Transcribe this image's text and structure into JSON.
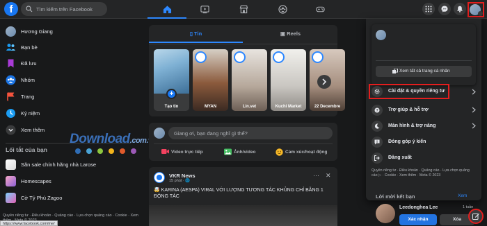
{
  "topbar": {
    "logo": "f",
    "search_placeholder": "Tìm kiếm trên Facebook",
    "nav_icons": [
      "home-icon",
      "watch-icon",
      "marketplace-icon",
      "groups-icon",
      "gaming-icon"
    ],
    "right_icons": [
      "menu-grid-icon",
      "messenger-icon",
      "notifications-icon"
    ]
  },
  "sidebar": {
    "items": [
      {
        "label": "Hương Giang",
        "icon": "avatar"
      },
      {
        "label": "Bạn bè",
        "icon": "friends-icon"
      },
      {
        "label": "Đã lưu",
        "icon": "saved-icon"
      },
      {
        "label": "Nhóm",
        "icon": "groups-icon"
      },
      {
        "label": "Trang",
        "icon": "pages-icon"
      },
      {
        "label": "Kỷ niệm",
        "icon": "memories-icon"
      },
      {
        "label": "Xem thêm",
        "icon": "chevron-down-icon"
      }
    ],
    "shortcuts_title": "Lối tắt của bạn",
    "shortcuts": [
      {
        "label": "Săn sale chính hãng nhà Larose"
      },
      {
        "label": "Homescapes"
      },
      {
        "label": "Cờ Tỷ Phú Zagoo"
      }
    ],
    "footer": "Quyền riêng tư · Điều khoản · Quảng cáo · Lựa chọn quảng cáo · Cookie · Xem thêm · Meta © 2023"
  },
  "status_url": "https://www.facebook.com/me/",
  "watermark": {
    "main": "Download",
    "tld": ".com.vn"
  },
  "stories": {
    "tabs": [
      "Tin",
      "Reels"
    ],
    "create_label": "Tạo tin",
    "items": [
      {
        "name": "MYAN"
      },
      {
        "name": "Lin.vet"
      },
      {
        "name": "Kuchi Market"
      },
      {
        "name": "22 Decembre"
      }
    ]
  },
  "composer": {
    "placeholder": "Giang ơi, bạn đang nghĩ gì thế?",
    "actions": [
      "Video trực tiếp",
      "Ảnh/video",
      "Cảm xúc/hoạt động"
    ]
  },
  "post": {
    "page_name": "VKR News",
    "meta": "15 phút · 🌐",
    "text": "🤯 KARINA (AESPA) VIRAL VỚI LƯỢNG TƯƠNG TÁC KHỦNG CHỈ BẰNG 1 ĐỘNG TÁC"
  },
  "account_menu": {
    "see_all_profiles": "Xem tất cả trang cá nhân",
    "items": [
      {
        "label": "Cài đặt & quyền riêng tư",
        "icon": "gear-icon",
        "highlight": true
      },
      {
        "label": "Trợ giúp & hỗ trợ",
        "icon": "help-icon"
      },
      {
        "label": "Màn hình & trợ năng",
        "icon": "moon-icon"
      },
      {
        "label": "Đóng góp ý kiến",
        "icon": "feedback-icon"
      },
      {
        "label": "Đăng xuất",
        "icon": "logout-icon"
      }
    ],
    "footer": "Quyền riêng tư · Điều khoản · Quảng cáo · Lựa chọn quảng cáo ▷ · Cookie · Xem thêm · Meta © 2023"
  },
  "friend_requests": {
    "title": "Lời mời kết bạn",
    "see_all": "Xem",
    "name": "Leedonghea Lee",
    "time": "1 tuần",
    "confirm": "Xác nhận",
    "delete": "Xóa"
  },
  "colors": {
    "accent": "#2d88ff",
    "highlight_border": "#e41e1e",
    "background": "#18191a",
    "card": "#242526"
  }
}
